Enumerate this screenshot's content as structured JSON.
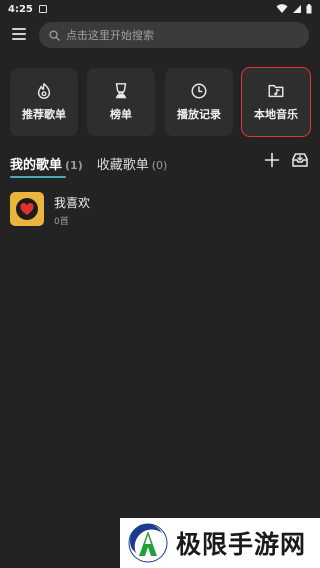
{
  "status_bar": {
    "time": "4:25"
  },
  "search": {
    "placeholder": "点击这里开始搜索"
  },
  "tiles": [
    {
      "label": "推荐歌单",
      "icon": "flame-disc-icon"
    },
    {
      "label": "榜单",
      "icon": "trophy-icon"
    },
    {
      "label": "播放记录",
      "icon": "clock-icon"
    },
    {
      "label": "本地音乐",
      "icon": "music-folder-icon",
      "highlighted": true
    }
  ],
  "tabs": [
    {
      "label": "我的歌单",
      "count": "(1)",
      "active": true
    },
    {
      "label": "收藏歌单",
      "count": "(0)",
      "active": false
    }
  ],
  "playlists": [
    {
      "title": "我喜欢",
      "count": "0首"
    }
  ],
  "watermark": {
    "text": "极限手游网"
  },
  "colors": {
    "background": "#232323",
    "tile": "#2e2e2e",
    "accent_underline": "#4fa8b8",
    "highlight_border": "#e03434",
    "cover": "#e9b53b",
    "heart": "#e03030"
  }
}
